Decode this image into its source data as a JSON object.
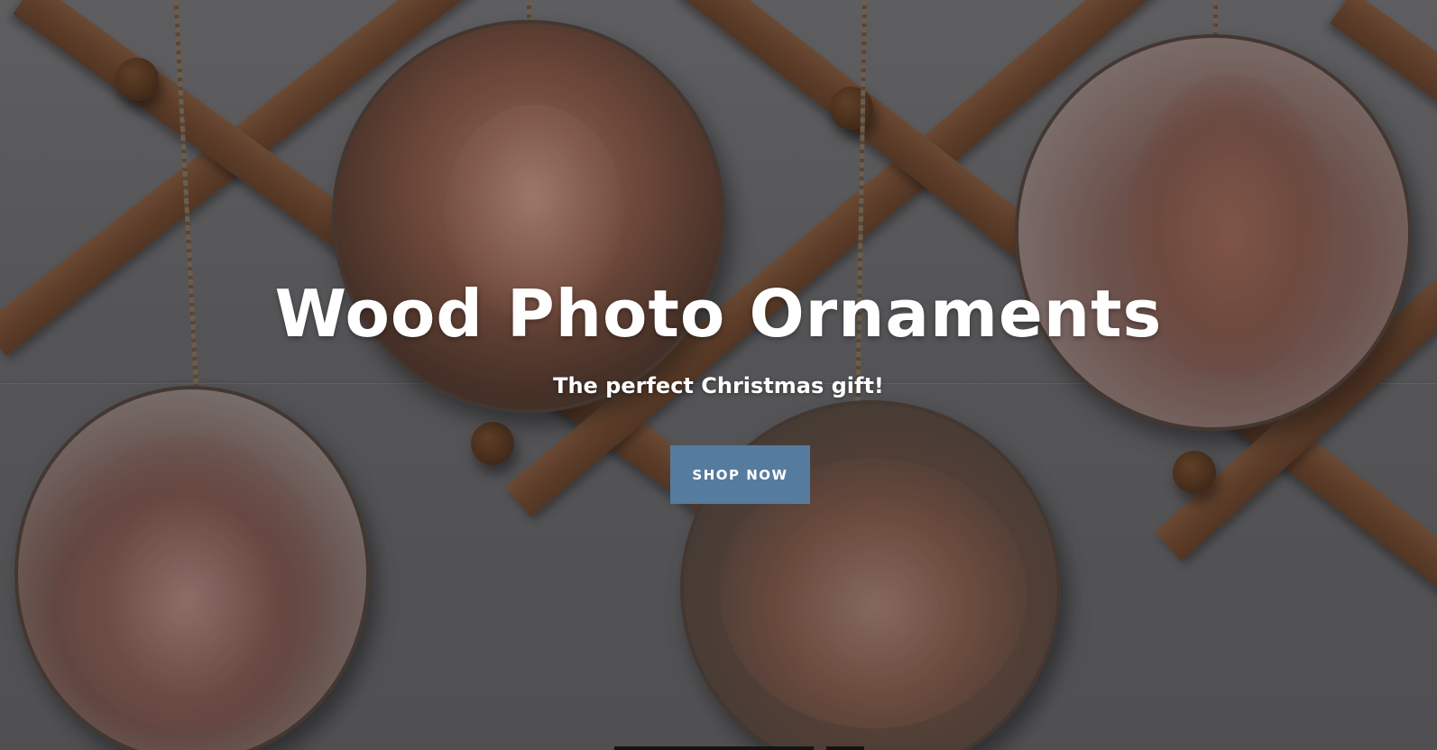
{
  "hero": {
    "title": "Wood Photo Ornaments",
    "subtitle": "The perfect Christmas gift!",
    "button_label": "SHOP NOW",
    "button_color": "#557b9f",
    "text_color": "#ffffff"
  },
  "slideshow": {
    "slide_count": 2,
    "active_slide": 1
  },
  "background_image": {
    "icon": "wood-photo-ornaments-photo"
  }
}
